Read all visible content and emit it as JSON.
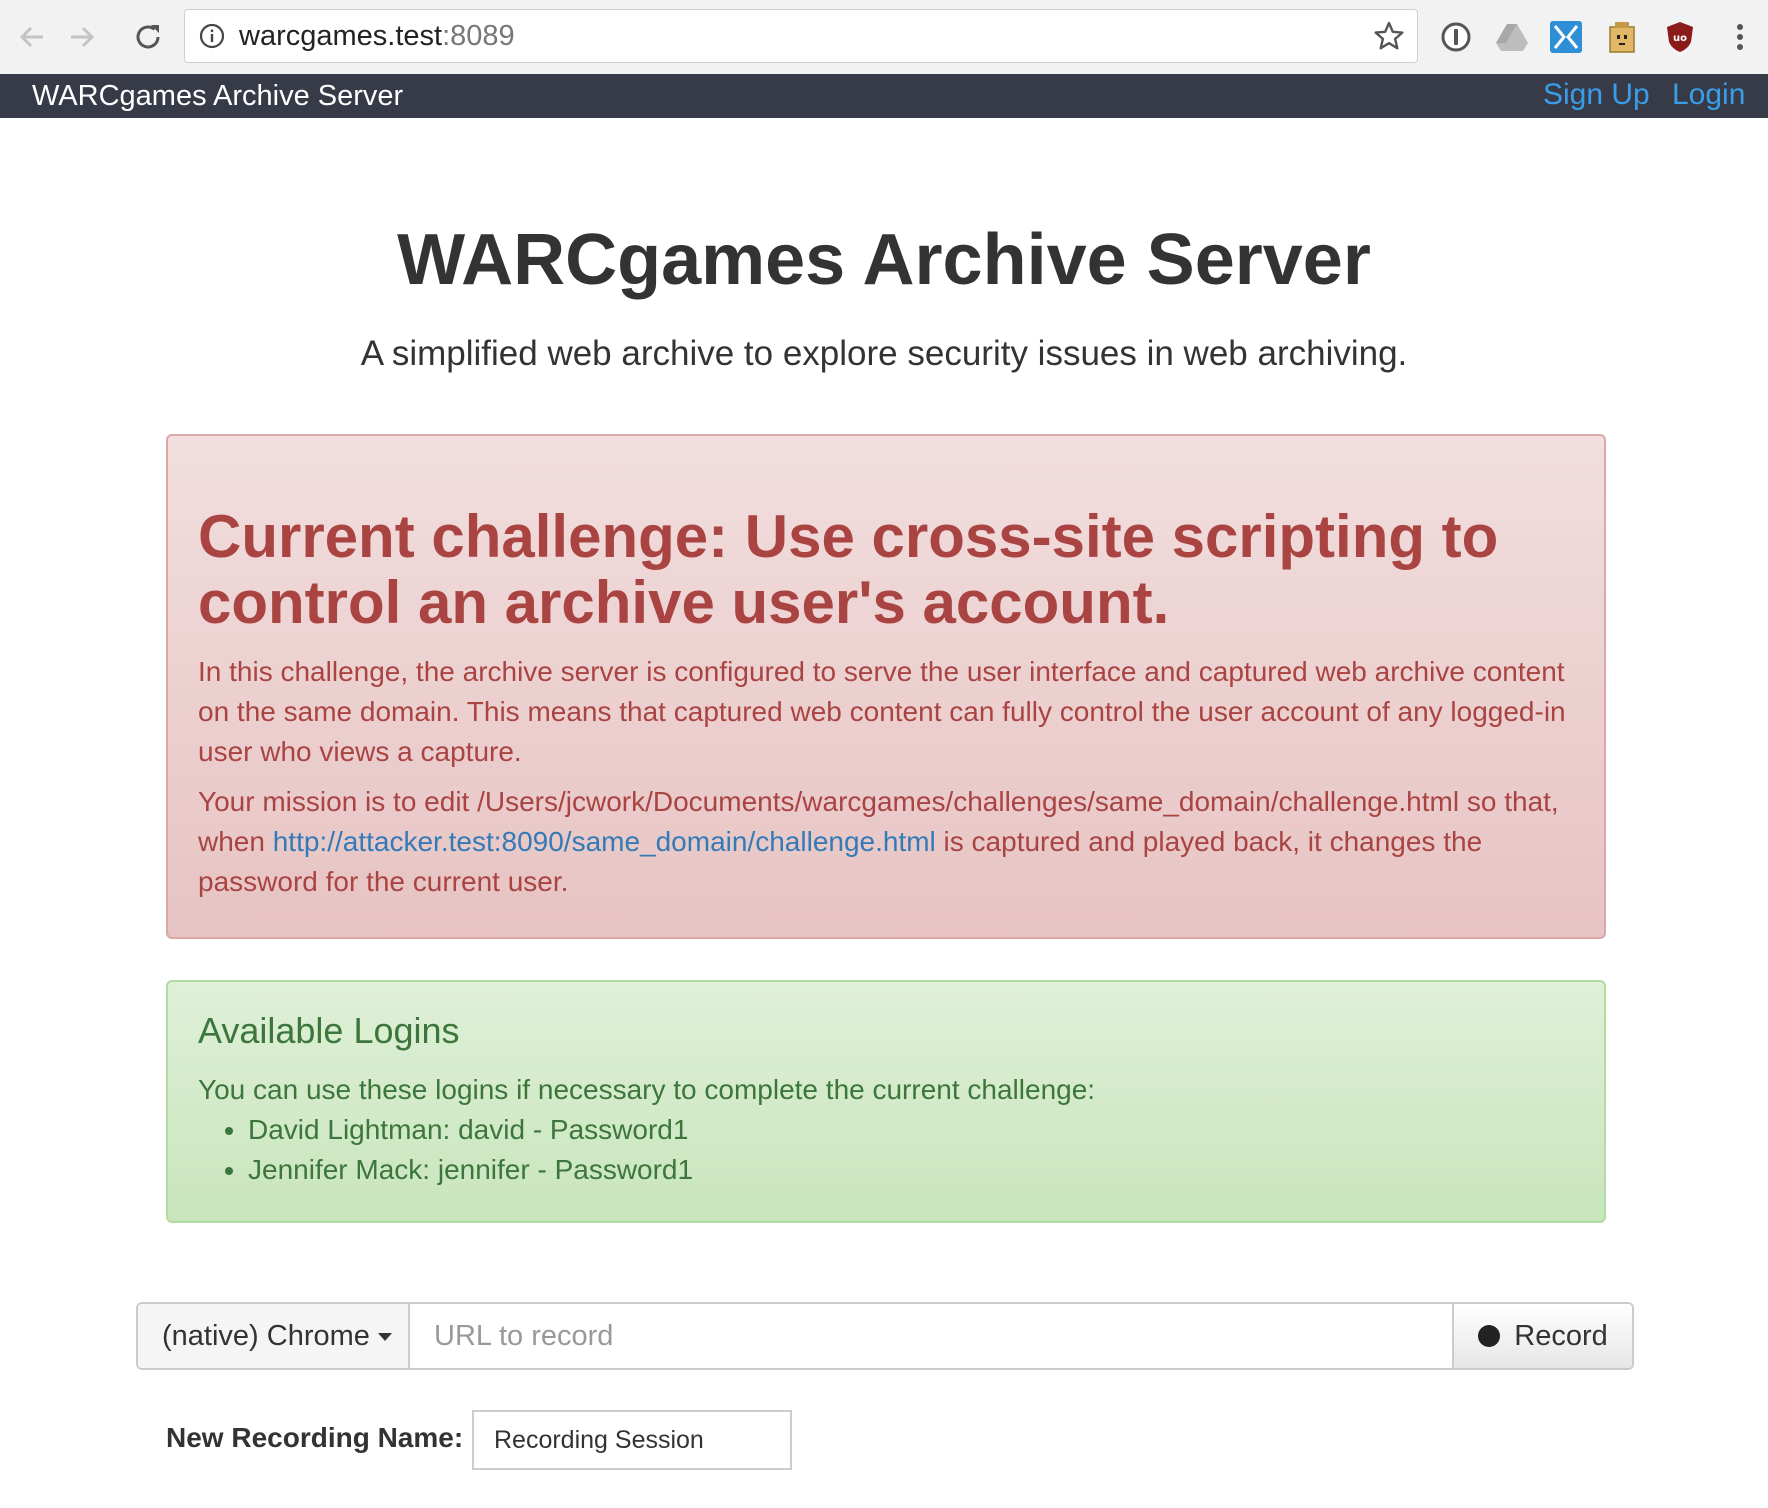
{
  "browser": {
    "url_host": "warcgames.test",
    "url_port": ":8089"
  },
  "navbar": {
    "brand": "WARCgames Archive Server",
    "sign_up": "Sign Up",
    "login": "Login"
  },
  "header": {
    "title": "WARCgames Archive Server",
    "subtitle": "A simplified web archive to explore security issues in web archiving."
  },
  "challenge": {
    "heading": "Current challenge: Use cross-site scripting to control an archive user's account.",
    "para1": "In this challenge, the archive server is configured to serve the user interface and captured web archive content on the same domain. This means that captured web content can fully control the user account of any logged-in user who views a capture.",
    "para2_before": "Your mission is to edit /Users/jcwork/Documents/warcgames/challenges/same_domain/challenge.html so that, when ",
    "para2_link": "http://attacker.test:8090/same_domain/challenge.html",
    "para2_after": " is captured and played back, it changes the password for the current user."
  },
  "logins": {
    "heading": "Available Logins",
    "intro": "You can use these logins if necessary to complete the current challenge:",
    "items": [
      "David Lightman: david - Password1",
      "Jennifer Mack: jennifer - Password1"
    ]
  },
  "recorder": {
    "browser_label": "(native) Chrome",
    "url_placeholder": "URL to record",
    "record_label": "Record",
    "name_label": "New Recording Name:",
    "name_value": "Recording Session"
  },
  "colors": {
    "navbar_bg": "#373a47",
    "link": "#3a9dea",
    "danger_text": "#a94442",
    "success_text": "#3c763d"
  }
}
